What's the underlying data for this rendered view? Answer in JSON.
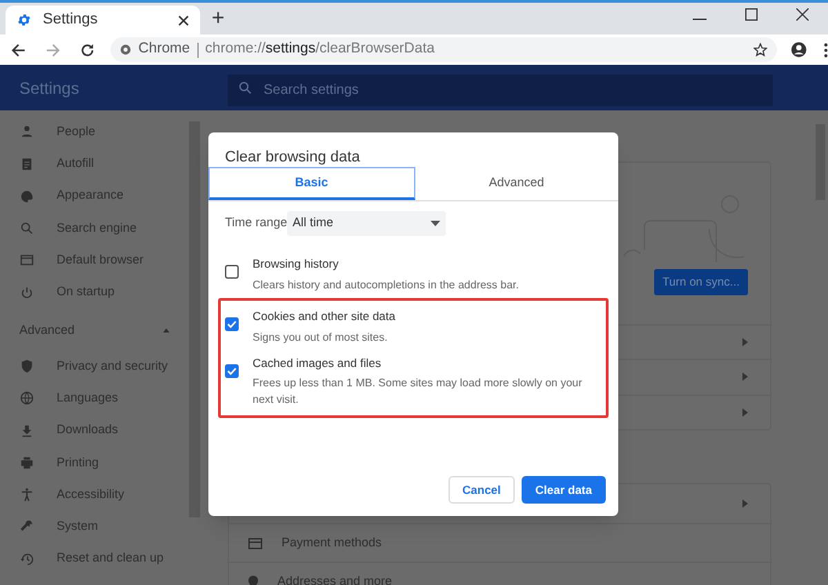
{
  "browser": {
    "tab": {
      "title": "Settings"
    },
    "new_tab": "+",
    "omnibox": {
      "site_label": "Chrome",
      "url_scheme": "chrome://",
      "url_host": "settings",
      "url_path": "/clearBrowserData"
    }
  },
  "settings_header": {
    "title": "Settings",
    "search": {
      "placeholder": "Search settings"
    }
  },
  "sidebar": {
    "items": [
      {
        "label": "People"
      },
      {
        "label": "Autofill"
      },
      {
        "label": "Appearance"
      },
      {
        "label": "Search engine"
      },
      {
        "label": "Default browser"
      },
      {
        "label": "On startup"
      }
    ],
    "advanced": {
      "label": "Advanced",
      "expanded": true,
      "items": [
        {
          "label": "Privacy and security"
        },
        {
          "label": "Languages"
        },
        {
          "label": "Downloads"
        },
        {
          "label": "Printing"
        },
        {
          "label": "Accessibility"
        },
        {
          "label": "System"
        },
        {
          "label": "Reset and clean up"
        }
      ]
    }
  },
  "background": {
    "sync_button": "Turn on sync...",
    "rows": [
      {
        "label": "Payment methods"
      },
      {
        "label": "Addresses and more"
      }
    ]
  },
  "dialog": {
    "title": "Clear browsing data",
    "tabs": [
      {
        "label": "Basic",
        "selected": true
      },
      {
        "label": "Advanced",
        "selected": false
      }
    ],
    "time_range": {
      "label": "Time range",
      "value": "All time"
    },
    "options": [
      {
        "title": "Browsing history",
        "description": "Clears history and autocompletions in the address bar.",
        "checked": false,
        "highlighted": false
      },
      {
        "title": "Cookies and other site data",
        "description": "Signs you out of most sites.",
        "checked": true,
        "highlighted": true
      },
      {
        "title": "Cached images and files",
        "description": "Frees up less than 1 MB. Some sites may load more slowly on your next visit.",
        "checked": true,
        "highlighted": true
      }
    ],
    "buttons": [
      {
        "label": "Cancel",
        "kind": "secondary"
      },
      {
        "label": "Clear data",
        "kind": "primary"
      }
    ]
  }
}
